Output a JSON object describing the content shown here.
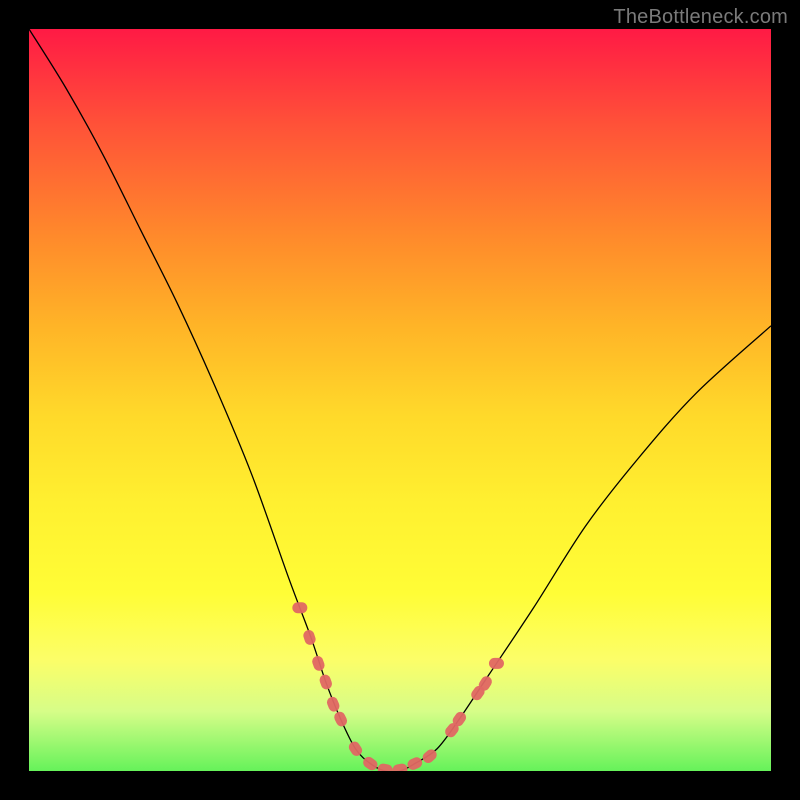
{
  "watermark": "TheBottleneck.com",
  "chart_data": {
    "type": "line",
    "title": "",
    "xlabel": "",
    "ylabel": "",
    "xlim": [
      0,
      100
    ],
    "ylim": [
      0,
      100
    ],
    "series": [
      {
        "name": "curve",
        "x": [
          0,
          5,
          10,
          15,
          20,
          25,
          30,
          35,
          38,
          40,
          42,
          44,
          46,
          48,
          50,
          52,
          55,
          58,
          62,
          68,
          75,
          82,
          90,
          100
        ],
        "y": [
          100,
          92,
          83,
          73,
          63,
          52,
          40,
          26,
          18,
          12,
          7,
          3,
          1,
          0,
          0,
          1,
          3,
          7,
          13,
          22,
          33,
          42,
          51,
          60
        ]
      }
    ],
    "markers": {
      "name": "highlight-points",
      "color": "#e06763",
      "x": [
        36.5,
        37.8,
        39.0,
        40.0,
        41.0,
        42.0,
        44.0,
        46.0,
        48.0,
        50.0,
        52.0,
        54.0,
        57.0,
        58.0,
        60.5,
        61.5,
        63.0
      ],
      "y": [
        22.0,
        18.0,
        14.5,
        12.0,
        9.0,
        7.0,
        3.0,
        1.0,
        0.2,
        0.2,
        1.0,
        2.0,
        5.5,
        7.0,
        10.5,
        11.8,
        14.5
      ]
    },
    "colors": {
      "gradient_top": "#ff1a45",
      "gradient_bottom": "#66f25a",
      "curve": "#000000",
      "markers": "#e06763"
    }
  }
}
